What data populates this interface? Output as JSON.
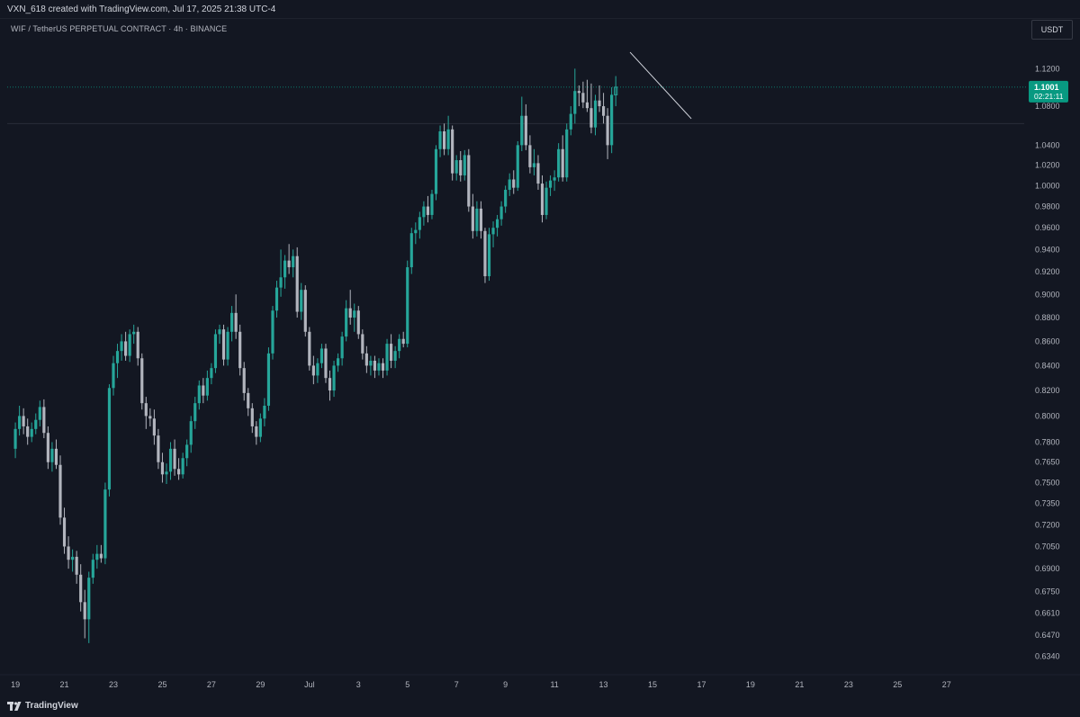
{
  "header": {
    "creator_text": "VXN_618 created with TradingView.com, Jul 17, 2025 21:38 UTC-4",
    "symbol_line": "WIF / TetherUS PERPETUAL CONTRACT · 4h · BINANCE",
    "currency": "USDT"
  },
  "price_label": {
    "value": "1.1001",
    "countdown": "02:21:11"
  },
  "footer": {
    "brand": "TradingView"
  },
  "colors": {
    "background": "#131722",
    "up": "#26a69a",
    "down": "#b2b5be",
    "price_line": "#089981",
    "trendline": "#d1d4dc"
  },
  "chart_data": {
    "type": "candlestick",
    "y_scale": "log",
    "ylim": [
      0.627,
      1.152
    ],
    "xlim": [
      -2,
      247
    ],
    "y_ticks": [
      1.12,
      1.08,
      1.04,
      1.02,
      1.0,
      0.98,
      0.96,
      0.94,
      0.92,
      0.9,
      0.88,
      0.86,
      0.84,
      0.82,
      0.8,
      0.78,
      0.765,
      0.75,
      0.735,
      0.72,
      0.705,
      0.69,
      0.675,
      0.661,
      0.647,
      0.634
    ],
    "y_tick_labels": [
      "1.1200",
      "1.0800",
      "1.0400",
      "1.0200",
      "1.0000",
      "0.9800",
      "0.9600",
      "0.9400",
      "0.9200",
      "0.9000",
      "0.8800",
      "0.8600",
      "0.8400",
      "0.8200",
      "0.8000",
      "0.7800",
      "0.7650",
      "0.7500",
      "0.7350",
      "0.7200",
      "0.7050",
      "0.6900",
      "0.6750",
      "0.6610",
      "0.6470",
      "0.6340"
    ],
    "x_ticks": [
      {
        "label": "19",
        "bar": 0
      },
      {
        "label": "21",
        "bar": 12
      },
      {
        "label": "23",
        "bar": 24
      },
      {
        "label": "25",
        "bar": 36
      },
      {
        "label": "27",
        "bar": 48
      },
      {
        "label": "29",
        "bar": 60
      },
      {
        "label": "Jul",
        "bar": 72
      },
      {
        "label": "3",
        "bar": 84
      },
      {
        "label": "5",
        "bar": 96
      },
      {
        "label": "7",
        "bar": 108
      },
      {
        "label": "9",
        "bar": 120
      },
      {
        "label": "11",
        "bar": 132
      },
      {
        "label": "13",
        "bar": 144
      },
      {
        "label": "15",
        "bar": 156
      },
      {
        "label": "17",
        "bar": 168
      },
      {
        "label": "19",
        "bar": 180
      },
      {
        "label": "21",
        "bar": 192
      },
      {
        "label": "23",
        "bar": 204
      },
      {
        "label": "25",
        "bar": 216
      },
      {
        "label": "27",
        "bar": 228
      }
    ],
    "candles": [
      {
        "o": 0.775,
        "h": 0.795,
        "l": 0.768,
        "c": 0.79
      },
      {
        "o": 0.79,
        "h": 0.808,
        "l": 0.785,
        "c": 0.8
      },
      {
        "o": 0.8,
        "h": 0.806,
        "l": 0.786,
        "c": 0.792
      },
      {
        "o": 0.792,
        "h": 0.798,
        "l": 0.778,
        "c": 0.784
      },
      {
        "o": 0.784,
        "h": 0.795,
        "l": 0.78,
        "c": 0.79
      },
      {
        "o": 0.79,
        "h": 0.802,
        "l": 0.786,
        "c": 0.797
      },
      {
        "o": 0.797,
        "h": 0.812,
        "l": 0.792,
        "c": 0.807
      },
      {
        "o": 0.807,
        "h": 0.813,
        "l": 0.783,
        "c": 0.787
      },
      {
        "o": 0.787,
        "h": 0.792,
        "l": 0.76,
        "c": 0.765
      },
      {
        "o": 0.765,
        "h": 0.78,
        "l": 0.758,
        "c": 0.775
      },
      {
        "o": 0.775,
        "h": 0.782,
        "l": 0.76,
        "c": 0.763
      },
      {
        "o": 0.763,
        "h": 0.77,
        "l": 0.72,
        "c": 0.725
      },
      {
        "o": 0.725,
        "h": 0.732,
        "l": 0.7,
        "c": 0.705
      },
      {
        "o": 0.705,
        "h": 0.712,
        "l": 0.69,
        "c": 0.696
      },
      {
        "o": 0.696,
        "h": 0.703,
        "l": 0.688,
        "c": 0.698
      },
      {
        "o": 0.698,
        "h": 0.702,
        "l": 0.68,
        "c": 0.686
      },
      {
        "o": 0.686,
        "h": 0.693,
        "l": 0.662,
        "c": 0.668
      },
      {
        "o": 0.668,
        "h": 0.676,
        "l": 0.645,
        "c": 0.657
      },
      {
        "o": 0.657,
        "h": 0.688,
        "l": 0.642,
        "c": 0.684
      },
      {
        "o": 0.684,
        "h": 0.7,
        "l": 0.68,
        "c": 0.696
      },
      {
        "o": 0.696,
        "h": 0.706,
        "l": 0.69,
        "c": 0.7
      },
      {
        "o": 0.7,
        "h": 0.706,
        "l": 0.694,
        "c": 0.697
      },
      {
        "o": 0.697,
        "h": 0.75,
        "l": 0.693,
        "c": 0.745
      },
      {
        "o": 0.745,
        "h": 0.825,
        "l": 0.74,
        "c": 0.822
      },
      {
        "o": 0.822,
        "h": 0.848,
        "l": 0.816,
        "c": 0.842
      },
      {
        "o": 0.842,
        "h": 0.858,
        "l": 0.83,
        "c": 0.852
      },
      {
        "o": 0.852,
        "h": 0.866,
        "l": 0.844,
        "c": 0.86
      },
      {
        "o": 0.86,
        "h": 0.868,
        "l": 0.844,
        "c": 0.848
      },
      {
        "o": 0.848,
        "h": 0.87,
        "l": 0.843,
        "c": 0.866
      },
      {
        "o": 0.866,
        "h": 0.874,
        "l": 0.858,
        "c": 0.868
      },
      {
        "o": 0.868,
        "h": 0.872,
        "l": 0.84,
        "c": 0.846
      },
      {
        "o": 0.846,
        "h": 0.85,
        "l": 0.805,
        "c": 0.81
      },
      {
        "o": 0.81,
        "h": 0.815,
        "l": 0.79,
        "c": 0.8
      },
      {
        "o": 0.8,
        "h": 0.806,
        "l": 0.792,
        "c": 0.798
      },
      {
        "o": 0.798,
        "h": 0.805,
        "l": 0.778,
        "c": 0.785
      },
      {
        "o": 0.785,
        "h": 0.79,
        "l": 0.76,
        "c": 0.765
      },
      {
        "o": 0.765,
        "h": 0.772,
        "l": 0.75,
        "c": 0.756
      },
      {
        "o": 0.756,
        "h": 0.764,
        "l": 0.749,
        "c": 0.758
      },
      {
        "o": 0.758,
        "h": 0.78,
        "l": 0.752,
        "c": 0.775
      },
      {
        "o": 0.775,
        "h": 0.782,
        "l": 0.755,
        "c": 0.76
      },
      {
        "o": 0.76,
        "h": 0.768,
        "l": 0.752,
        "c": 0.756
      },
      {
        "o": 0.756,
        "h": 0.772,
        "l": 0.753,
        "c": 0.768
      },
      {
        "o": 0.768,
        "h": 0.782,
        "l": 0.762,
        "c": 0.778
      },
      {
        "o": 0.778,
        "h": 0.8,
        "l": 0.772,
        "c": 0.796
      },
      {
        "o": 0.796,
        "h": 0.815,
        "l": 0.79,
        "c": 0.81
      },
      {
        "o": 0.81,
        "h": 0.828,
        "l": 0.805,
        "c": 0.824
      },
      {
        "o": 0.824,
        "h": 0.83,
        "l": 0.81,
        "c": 0.816
      },
      {
        "o": 0.816,
        "h": 0.836,
        "l": 0.812,
        "c": 0.83
      },
      {
        "o": 0.83,
        "h": 0.842,
        "l": 0.825,
        "c": 0.838
      },
      {
        "o": 0.838,
        "h": 0.87,
        "l": 0.834,
        "c": 0.866
      },
      {
        "o": 0.866,
        "h": 0.874,
        "l": 0.858,
        "c": 0.87
      },
      {
        "o": 0.87,
        "h": 0.874,
        "l": 0.84,
        "c": 0.845
      },
      {
        "o": 0.845,
        "h": 0.872,
        "l": 0.84,
        "c": 0.868
      },
      {
        "o": 0.868,
        "h": 0.89,
        "l": 0.86,
        "c": 0.884
      },
      {
        "o": 0.884,
        "h": 0.9,
        "l": 0.862,
        "c": 0.868
      },
      {
        "o": 0.868,
        "h": 0.874,
        "l": 0.832,
        "c": 0.838
      },
      {
        "o": 0.838,
        "h": 0.843,
        "l": 0.812,
        "c": 0.818
      },
      {
        "o": 0.818,
        "h": 0.822,
        "l": 0.8,
        "c": 0.806
      },
      {
        "o": 0.806,
        "h": 0.81,
        "l": 0.787,
        "c": 0.792
      },
      {
        "o": 0.792,
        "h": 0.796,
        "l": 0.778,
        "c": 0.784
      },
      {
        "o": 0.784,
        "h": 0.802,
        "l": 0.78,
        "c": 0.798
      },
      {
        "o": 0.798,
        "h": 0.814,
        "l": 0.792,
        "c": 0.808
      },
      {
        "o": 0.808,
        "h": 0.855,
        "l": 0.804,
        "c": 0.85
      },
      {
        "o": 0.85,
        "h": 0.89,
        "l": 0.845,
        "c": 0.886
      },
      {
        "o": 0.886,
        "h": 0.912,
        "l": 0.88,
        "c": 0.906
      },
      {
        "o": 0.906,
        "h": 0.94,
        "l": 0.898,
        "c": 0.915
      },
      {
        "o": 0.915,
        "h": 0.935,
        "l": 0.905,
        "c": 0.93
      },
      {
        "o": 0.93,
        "h": 0.945,
        "l": 0.918,
        "c": 0.924
      },
      {
        "o": 0.924,
        "h": 0.94,
        "l": 0.915,
        "c": 0.934
      },
      {
        "o": 0.934,
        "h": 0.942,
        "l": 0.88,
        "c": 0.885
      },
      {
        "o": 0.885,
        "h": 0.91,
        "l": 0.878,
        "c": 0.904
      },
      {
        "o": 0.904,
        "h": 0.908,
        "l": 0.864,
        "c": 0.868
      },
      {
        "o": 0.868,
        "h": 0.872,
        "l": 0.836,
        "c": 0.84
      },
      {
        "o": 0.84,
        "h": 0.848,
        "l": 0.825,
        "c": 0.832
      },
      {
        "o": 0.832,
        "h": 0.846,
        "l": 0.826,
        "c": 0.842
      },
      {
        "o": 0.842,
        "h": 0.858,
        "l": 0.838,
        "c": 0.854
      },
      {
        "o": 0.854,
        "h": 0.858,
        "l": 0.826,
        "c": 0.83
      },
      {
        "o": 0.83,
        "h": 0.836,
        "l": 0.812,
        "c": 0.82
      },
      {
        "o": 0.82,
        "h": 0.844,
        "l": 0.815,
        "c": 0.84
      },
      {
        "o": 0.84,
        "h": 0.85,
        "l": 0.835,
        "c": 0.846
      },
      {
        "o": 0.846,
        "h": 0.868,
        "l": 0.84,
        "c": 0.864
      },
      {
        "o": 0.864,
        "h": 0.895,
        "l": 0.86,
        "c": 0.888
      },
      {
        "o": 0.888,
        "h": 0.904,
        "l": 0.874,
        "c": 0.88
      },
      {
        "o": 0.88,
        "h": 0.892,
        "l": 0.868,
        "c": 0.886
      },
      {
        "o": 0.886,
        "h": 0.89,
        "l": 0.862,
        "c": 0.866
      },
      {
        "o": 0.866,
        "h": 0.87,
        "l": 0.845,
        "c": 0.85
      },
      {
        "o": 0.85,
        "h": 0.856,
        "l": 0.834,
        "c": 0.84
      },
      {
        "o": 0.84,
        "h": 0.848,
        "l": 0.832,
        "c": 0.844
      },
      {
        "o": 0.844,
        "h": 0.848,
        "l": 0.83,
        "c": 0.836
      },
      {
        "o": 0.836,
        "h": 0.846,
        "l": 0.832,
        "c": 0.842
      },
      {
        "o": 0.842,
        "h": 0.846,
        "l": 0.83,
        "c": 0.836
      },
      {
        "o": 0.836,
        "h": 0.862,
        "l": 0.832,
        "c": 0.858
      },
      {
        "o": 0.858,
        "h": 0.866,
        "l": 0.838,
        "c": 0.844
      },
      {
        "o": 0.844,
        "h": 0.856,
        "l": 0.838,
        "c": 0.852
      },
      {
        "o": 0.852,
        "h": 0.866,
        "l": 0.846,
        "c": 0.862
      },
      {
        "o": 0.862,
        "h": 0.868,
        "l": 0.855,
        "c": 0.858
      },
      {
        "o": 0.858,
        "h": 0.93,
        "l": 0.855,
        "c": 0.924
      },
      {
        "o": 0.924,
        "h": 0.96,
        "l": 0.918,
        "c": 0.955
      },
      {
        "o": 0.955,
        "h": 0.965,
        "l": 0.945,
        "c": 0.958
      },
      {
        "o": 0.958,
        "h": 0.975,
        "l": 0.95,
        "c": 0.97
      },
      {
        "o": 0.97,
        "h": 0.985,
        "l": 0.962,
        "c": 0.98
      },
      {
        "o": 0.98,
        "h": 0.99,
        "l": 0.965,
        "c": 0.972
      },
      {
        "o": 0.972,
        "h": 0.996,
        "l": 0.968,
        "c": 0.992
      },
      {
        "o": 0.992,
        "h": 1.04,
        "l": 0.986,
        "c": 1.036
      },
      {
        "o": 1.036,
        "h": 1.06,
        "l": 1.028,
        "c": 1.054
      },
      {
        "o": 1.054,
        "h": 1.062,
        "l": 1.03,
        "c": 1.036
      },
      {
        "o": 1.036,
        "h": 1.07,
        "l": 1.03,
        "c": 1.056
      },
      {
        "o": 1.056,
        "h": 1.06,
        "l": 1.005,
        "c": 1.012
      },
      {
        "o": 1.012,
        "h": 1.03,
        "l": 1.005,
        "c": 1.025
      },
      {
        "o": 1.025,
        "h": 1.034,
        "l": 1.004,
        "c": 1.01
      },
      {
        "o": 1.01,
        "h": 1.035,
        "l": 1.005,
        "c": 1.03
      },
      {
        "o": 1.03,
        "h": 1.036,
        "l": 0.975,
        "c": 0.98
      },
      {
        "o": 0.98,
        "h": 0.992,
        "l": 0.95,
        "c": 0.957
      },
      {
        "o": 0.957,
        "h": 0.985,
        "l": 0.952,
        "c": 0.978
      },
      {
        "o": 0.978,
        "h": 0.985,
        "l": 0.95,
        "c": 0.957
      },
      {
        "o": 0.957,
        "h": 0.96,
        "l": 0.91,
        "c": 0.916
      },
      {
        "o": 0.916,
        "h": 0.96,
        "l": 0.912,
        "c": 0.954
      },
      {
        "o": 0.954,
        "h": 0.966,
        "l": 0.942,
        "c": 0.96
      },
      {
        "o": 0.96,
        "h": 0.972,
        "l": 0.952,
        "c": 0.968
      },
      {
        "o": 0.968,
        "h": 0.985,
        "l": 0.962,
        "c": 0.98
      },
      {
        "o": 0.98,
        "h": 1.0,
        "l": 0.974,
        "c": 0.996
      },
      {
        "o": 0.996,
        "h": 1.012,
        "l": 0.99,
        "c": 1.006
      },
      {
        "o": 1.006,
        "h": 1.015,
        "l": 0.992,
        "c": 0.998
      },
      {
        "o": 0.998,
        "h": 1.044,
        "l": 0.995,
        "c": 1.04
      },
      {
        "o": 1.04,
        "h": 1.09,
        "l": 1.034,
        "c": 1.07
      },
      {
        "o": 1.07,
        "h": 1.082,
        "l": 1.035,
        "c": 1.04
      },
      {
        "o": 1.04,
        "h": 1.05,
        "l": 1.012,
        "c": 1.018
      },
      {
        "o": 1.018,
        "h": 1.036,
        "l": 1.01,
        "c": 1.022
      },
      {
        "o": 1.022,
        "h": 1.03,
        "l": 0.996,
        "c": 1.002
      },
      {
        "o": 1.002,
        "h": 1.01,
        "l": 0.965,
        "c": 0.972
      },
      {
        "o": 0.972,
        "h": 1.004,
        "l": 0.968,
        "c": 0.998
      },
      {
        "o": 0.998,
        "h": 1.01,
        "l": 0.99,
        "c": 1.005
      },
      {
        "o": 1.005,
        "h": 1.015,
        "l": 0.995,
        "c": 1.008
      },
      {
        "o": 1.008,
        "h": 1.042,
        "l": 1.004,
        "c": 1.036
      },
      {
        "o": 1.036,
        "h": 1.05,
        "l": 1.004,
        "c": 1.008
      },
      {
        "o": 1.008,
        "h": 1.062,
        "l": 1.004,
        "c": 1.056
      },
      {
        "o": 1.056,
        "h": 1.08,
        "l": 1.05,
        "c": 1.072
      },
      {
        "o": 1.072,
        "h": 1.12,
        "l": 1.062,
        "c": 1.096
      },
      {
        "o": 1.096,
        "h": 1.102,
        "l": 1.08,
        "c": 1.094
      },
      {
        "o": 1.094,
        "h": 1.106,
        "l": 1.078,
        "c": 1.084
      },
      {
        "o": 1.084,
        "h": 1.108,
        "l": 1.074,
        "c": 1.078
      },
      {
        "o": 1.078,
        "h": 1.104,
        "l": 1.052,
        "c": 1.058
      },
      {
        "o": 1.058,
        "h": 1.092,
        "l": 1.05,
        "c": 1.086
      },
      {
        "o": 1.086,
        "h": 1.102,
        "l": 1.074,
        "c": 1.08
      },
      {
        "o": 1.08,
        "h": 1.094,
        "l": 1.062,
        "c": 1.07
      },
      {
        "o": 1.07,
        "h": 1.078,
        "l": 1.026,
        "c": 1.04
      },
      {
        "o": 1.04,
        "h": 1.1,
        "l": 1.032,
        "c": 1.092
      },
      {
        "o": 1.092,
        "h": 1.112,
        "l": 1.08,
        "c": 1.1001
      }
    ],
    "last_price": 1.1001,
    "reference_level": 1.062,
    "trendline": [
      {
        "bar": 150.5,
        "price": 1.138
      },
      {
        "bar": 165.5,
        "price": 1.067
      }
    ]
  }
}
